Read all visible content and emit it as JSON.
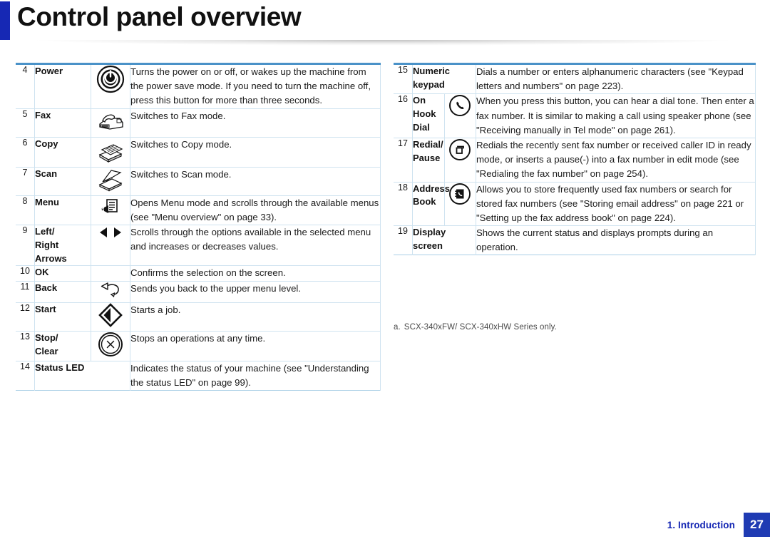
{
  "header": {
    "title": "Control panel overview",
    "accent_color": "#1628b4"
  },
  "table_border_color": "#4a92c8",
  "left_table": {
    "rows": [
      {
        "num": "4",
        "label": "Power",
        "icon": "power-button-icon",
        "desc": "Turns the power on or off, or wakes up the machine from the power save mode. If you need to turn the machine off, press this button for more than three seconds."
      },
      {
        "num": "5",
        "label": "Fax",
        "icon": "fax-machine-icon",
        "desc": "Switches to Fax mode."
      },
      {
        "num": "6",
        "label": "Copy",
        "icon": "copy-documents-icon",
        "desc": "Switches to Copy mode."
      },
      {
        "num": "7",
        "label": "Scan",
        "icon": "scanner-icon",
        "desc": "Switches to Scan mode."
      },
      {
        "num": "8",
        "label": "Menu",
        "icon": "menu-list-icon",
        "desc": "Opens Menu mode and scrolls through the available menus (see \"Menu overview\" on page 33)."
      },
      {
        "num": "9",
        "label": "Left/ Right Arrows",
        "label_lines": [
          "Left/",
          "Right",
          "Arrows"
        ],
        "icon": "left-right-arrows-icon",
        "desc": "Scrolls through the options available in the selected menu and increases or decreases values."
      },
      {
        "num": "10",
        "label": "OK",
        "icon": "",
        "desc": "Confirms the selection on the screen."
      },
      {
        "num": "11",
        "label": "Back",
        "icon": "back-arrow-icon",
        "desc": "Sends you back to the upper menu level."
      },
      {
        "num": "12",
        "label": "Start",
        "icon": "start-diamond-icon",
        "desc": "Starts a job."
      },
      {
        "num": "13",
        "label": "Stop/ Clear",
        "label_lines": [
          "Stop/",
          "Clear"
        ],
        "icon": "stop-clear-icon",
        "desc": "Stops an operations at any time."
      },
      {
        "num": "14",
        "label": "Status LED",
        "icon": "",
        "desc": "Indicates the status of your machine (see \"Understanding the status LED\" on page 99)."
      }
    ]
  },
  "right_table": {
    "rows": [
      {
        "num": "15",
        "label": "Numeric keypad",
        "icon": "",
        "span_label": true,
        "desc": "Dials a number or enters alphanumeric characters (see \"Keypad letters and numbers\" on page 223)."
      },
      {
        "num": "16",
        "label": "On Hook Dial",
        "label_lines": [
          "On Hook",
          "Dial"
        ],
        "icon": "on-hook-dial-icon",
        "desc": "When you press this button, you can hear a dial tone. Then enter a fax number. It is similar to making a call using speaker phone (see \"Receiving manually in Tel mode\" on page 261)."
      },
      {
        "num": "17",
        "label": "Redial/ Pause",
        "label_lines": [
          "Redial/",
          "Pause"
        ],
        "icon": "redial-pause-icon",
        "desc": "Redials the recently sent fax number or received caller ID in ready mode, or inserts a pause(-) into a fax number in edit mode (see \"Redialing the fax number\" on page 254)."
      },
      {
        "num": "18",
        "label": "Address Book",
        "label_lines": [
          "Address",
          "Book"
        ],
        "icon": "address-book-icon",
        "desc": "Allows you to store frequently used fax numbers or search for stored fax numbers (see \"Storing email address\" on page 221 or \"Setting up the fax address book\" on page 224)."
      },
      {
        "num": "19",
        "label": "Display screen",
        "icon": "",
        "span_label": true,
        "desc": "Shows the current status and displays prompts during an operation."
      }
    ]
  },
  "footnote": {
    "marker": "a.",
    "text": "SCX-340xFW/ SCX-340xHW Series only."
  },
  "footer": {
    "section": "1. Introduction",
    "page_number": "27",
    "accent_color": "#1f3bb3"
  }
}
